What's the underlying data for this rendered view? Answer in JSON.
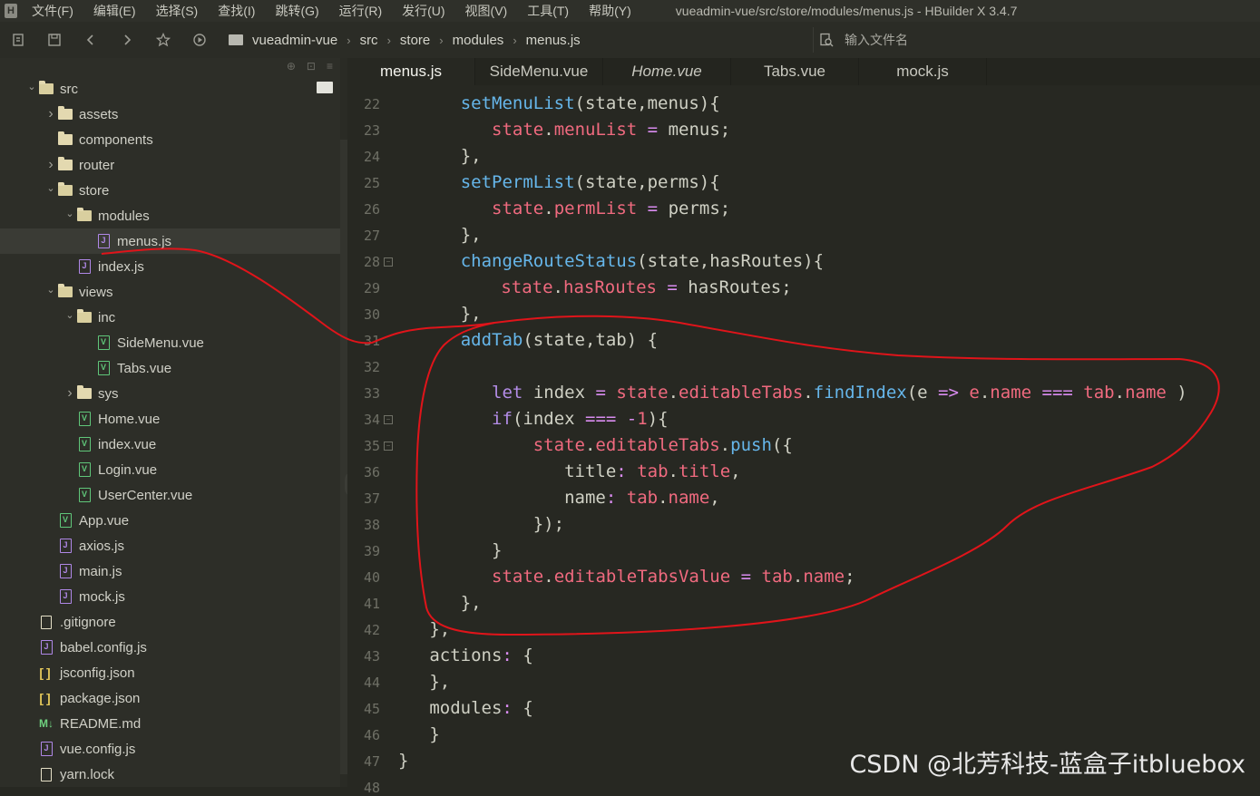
{
  "app": {
    "title": "vueadmin-vue/src/store/modules/menus.js - HBuilder X 3.4.7",
    "logo": "H"
  },
  "menu": [
    "文件(F)",
    "编辑(E)",
    "选择(S)",
    "查找(I)",
    "跳转(G)",
    "运行(R)",
    "发行(U)",
    "视图(V)",
    "工具(T)",
    "帮助(Y)"
  ],
  "toolbar": {
    "icons": [
      "new-file-icon",
      "save-icon",
      "back-icon",
      "forward-icon",
      "star-icon",
      "run-icon"
    ],
    "breadcrumb": [
      "vueadmin-vue",
      "src",
      "store",
      "modules",
      "menus.js"
    ],
    "search_placeholder": "输入文件名"
  },
  "tree": [
    {
      "label": "src",
      "type": "folder",
      "depth": 0,
      "expanded": true
    },
    {
      "label": "assets",
      "type": "folder",
      "depth": 1,
      "expanded": false
    },
    {
      "label": "components",
      "type": "folder",
      "depth": 1,
      "expanded": null
    },
    {
      "label": "router",
      "type": "folder",
      "depth": 1,
      "expanded": false
    },
    {
      "label": "store",
      "type": "folder",
      "depth": 1,
      "expanded": true
    },
    {
      "label": "modules",
      "type": "folder",
      "depth": 2,
      "expanded": true
    },
    {
      "label": "menus.js",
      "type": "js",
      "depth": 3,
      "selected": true
    },
    {
      "label": "index.js",
      "type": "js",
      "depth": 2
    },
    {
      "label": "views",
      "type": "folder",
      "depth": 1,
      "expanded": true
    },
    {
      "label": "inc",
      "type": "folder",
      "depth": 2,
      "expanded": true
    },
    {
      "label": "SideMenu.vue",
      "type": "vue",
      "depth": 3
    },
    {
      "label": "Tabs.vue",
      "type": "vue",
      "depth": 3
    },
    {
      "label": "sys",
      "type": "folder",
      "depth": 2,
      "expanded": false
    },
    {
      "label": "Home.vue",
      "type": "vue",
      "depth": 2
    },
    {
      "label": "index.vue",
      "type": "vue",
      "depth": 2
    },
    {
      "label": "Login.vue",
      "type": "vue",
      "depth": 2
    },
    {
      "label": "UserCenter.vue",
      "type": "vue",
      "depth": 2
    },
    {
      "label": "App.vue",
      "type": "vue",
      "depth": 1
    },
    {
      "label": "axios.js",
      "type": "js",
      "depth": 1
    },
    {
      "label": "main.js",
      "type": "js",
      "depth": 1
    },
    {
      "label": "mock.js",
      "type": "js",
      "depth": 1
    },
    {
      "label": ".gitignore",
      "type": "plain",
      "depth": 0
    },
    {
      "label": "babel.config.js",
      "type": "js",
      "depth": 0
    },
    {
      "label": "jsconfig.json",
      "type": "json",
      "depth": 0
    },
    {
      "label": "package.json",
      "type": "json",
      "depth": 0
    },
    {
      "label": "README.md",
      "type": "md",
      "depth": 0
    },
    {
      "label": "vue.config.js",
      "type": "js",
      "depth": 0
    },
    {
      "label": "yarn.lock",
      "type": "plain",
      "depth": 0
    }
  ],
  "tabs": [
    {
      "label": "menus.js",
      "active": true,
      "italic": false
    },
    {
      "label": "SideMenu.vue",
      "active": false,
      "italic": false
    },
    {
      "label": "Home.vue",
      "active": false,
      "italic": true
    },
    {
      "label": "Tabs.vue",
      "active": false,
      "italic": false
    },
    {
      "label": "mock.js",
      "active": false,
      "italic": false
    }
  ],
  "code": [
    {
      "ln": "22",
      "indent": 2,
      "fold": false,
      "tokens": [
        [
          "fn",
          "setMenuList"
        ],
        [
          "tx",
          "(state,menus){"
        ]
      ]
    },
    {
      "ln": "23",
      "indent": 3,
      "fold": false,
      "tokens": [
        [
          "pr",
          "state"
        ],
        [
          "tx",
          "."
        ],
        [
          "pr",
          "menuList"
        ],
        [
          "tx",
          " "
        ],
        [
          "op",
          "="
        ],
        [
          "tx",
          " menus;"
        ]
      ]
    },
    {
      "ln": "24",
      "indent": 2,
      "fold": false,
      "tokens": [
        [
          "tx",
          "},"
        ]
      ]
    },
    {
      "ln": "25",
      "indent": 2,
      "fold": false,
      "tokens": [
        [
          "fn",
          "setPermList"
        ],
        [
          "tx",
          "(state,perms){"
        ]
      ]
    },
    {
      "ln": "26",
      "indent": 3,
      "fold": false,
      "tokens": [
        [
          "pr",
          "state"
        ],
        [
          "tx",
          "."
        ],
        [
          "pr",
          "permList"
        ],
        [
          "tx",
          " "
        ],
        [
          "op",
          "="
        ],
        [
          "tx",
          " perms;"
        ]
      ]
    },
    {
      "ln": "27",
      "indent": 2,
      "fold": false,
      "tokens": [
        [
          "tx",
          "},"
        ]
      ]
    },
    {
      "ln": "28",
      "indent": 2,
      "fold": true,
      "tokens": [
        [
          "fn",
          "changeRouteStatus"
        ],
        [
          "tx",
          "(state,hasRoutes){"
        ]
      ]
    },
    {
      "ln": "29",
      "indent": 3.3,
      "fold": false,
      "tokens": [
        [
          "pr",
          "state"
        ],
        [
          "tx",
          "."
        ],
        [
          "pr",
          "hasRoutes"
        ],
        [
          "tx",
          " "
        ],
        [
          "op",
          "="
        ],
        [
          "tx",
          " hasRoutes;"
        ]
      ]
    },
    {
      "ln": "30",
      "indent": 2,
      "fold": false,
      "tokens": [
        [
          "tx",
          "},"
        ]
      ]
    },
    {
      "ln": "31",
      "indent": 2,
      "fold": false,
      "tokens": [
        [
          "fn",
          "addTab"
        ],
        [
          "tx",
          "(state,tab) {"
        ]
      ]
    },
    {
      "ln": "32",
      "indent": 0,
      "fold": false,
      "tokens": []
    },
    {
      "ln": "33",
      "indent": 3,
      "fold": false,
      "tokens": [
        [
          "kw",
          "let"
        ],
        [
          "tx",
          " index "
        ],
        [
          "op",
          "="
        ],
        [
          "tx",
          " "
        ],
        [
          "pr",
          "state"
        ],
        [
          "tx",
          "."
        ],
        [
          "pr",
          "editableTabs"
        ],
        [
          "tx",
          "."
        ],
        [
          "fn",
          "findIndex"
        ],
        [
          "tx",
          "(e "
        ],
        [
          "op",
          "=>"
        ],
        [
          "tx",
          " "
        ],
        [
          "pr",
          "e"
        ],
        [
          "tx",
          "."
        ],
        [
          "pr",
          "name"
        ],
        [
          "tx",
          " "
        ],
        [
          "op",
          "==="
        ],
        [
          "tx",
          " "
        ],
        [
          "pr",
          "tab"
        ],
        [
          "tx",
          "."
        ],
        [
          "pr",
          "name"
        ],
        [
          "tx",
          " )"
        ]
      ]
    },
    {
      "ln": "34",
      "indent": 3,
      "fold": true,
      "tokens": [
        [
          "kw",
          "if"
        ],
        [
          "tx",
          "(index "
        ],
        [
          "op",
          "==="
        ],
        [
          "tx",
          " "
        ],
        [
          "op",
          "-"
        ],
        [
          "nm",
          "1"
        ],
        [
          "tx",
          "){"
        ]
      ]
    },
    {
      "ln": "35",
      "indent": 4.33,
      "fold": true,
      "tokens": [
        [
          "pr",
          "state"
        ],
        [
          "tx",
          "."
        ],
        [
          "pr",
          "editableTabs"
        ],
        [
          "tx",
          "."
        ],
        [
          "fn",
          "push"
        ],
        [
          "tx",
          "({"
        ]
      ]
    },
    {
      "ln": "36",
      "indent": 5.33,
      "fold": false,
      "tokens": [
        [
          "tx",
          "title"
        ],
        [
          "op",
          ":"
        ],
        [
          "tx",
          " "
        ],
        [
          "pr",
          "tab"
        ],
        [
          "tx",
          "."
        ],
        [
          "pr",
          "title"
        ],
        [
          "tx",
          ","
        ]
      ]
    },
    {
      "ln": "37",
      "indent": 5.33,
      "fold": false,
      "tokens": [
        [
          "tx",
          "name"
        ],
        [
          "op",
          ":"
        ],
        [
          "tx",
          " "
        ],
        [
          "pr",
          "tab"
        ],
        [
          "tx",
          "."
        ],
        [
          "pr",
          "name"
        ],
        [
          "tx",
          ","
        ]
      ]
    },
    {
      "ln": "38",
      "indent": 4.33,
      "fold": false,
      "tokens": [
        [
          "tx",
          "});"
        ]
      ]
    },
    {
      "ln": "39",
      "indent": 3,
      "fold": false,
      "tokens": [
        [
          "tx",
          "}"
        ]
      ]
    },
    {
      "ln": "40",
      "indent": 3,
      "fold": false,
      "tokens": [
        [
          "pr",
          "state"
        ],
        [
          "tx",
          "."
        ],
        [
          "pr",
          "editableTabsValue"
        ],
        [
          "tx",
          " "
        ],
        [
          "op",
          "="
        ],
        [
          "tx",
          " "
        ],
        [
          "pr",
          "tab"
        ],
        [
          "tx",
          "."
        ],
        [
          "pr",
          "name"
        ],
        [
          "tx",
          ";"
        ]
      ]
    },
    {
      "ln": "41",
      "indent": 2,
      "fold": false,
      "tokens": [
        [
          "tx",
          "},"
        ]
      ]
    },
    {
      "ln": "42",
      "indent": 1,
      "fold": false,
      "tokens": [
        [
          "tx",
          "},"
        ]
      ]
    },
    {
      "ln": "43",
      "indent": 1,
      "fold": false,
      "tokens": [
        [
          "tx",
          "actions"
        ],
        [
          "op",
          ":"
        ],
        [
          "tx",
          " {"
        ]
      ]
    },
    {
      "ln": "44",
      "indent": 1,
      "fold": false,
      "tokens": [
        [
          "tx",
          "},"
        ]
      ]
    },
    {
      "ln": "45",
      "indent": 1,
      "fold": false,
      "tokens": [
        [
          "tx",
          "modules"
        ],
        [
          "op",
          ":"
        ],
        [
          "tx",
          " {"
        ]
      ]
    },
    {
      "ln": "46",
      "indent": 1,
      "fold": false,
      "tokens": [
        [
          "tx",
          "}"
        ]
      ]
    },
    {
      "ln": "47",
      "indent": 0,
      "fold": false,
      "tokens": [
        [
          "tx",
          "}"
        ]
      ]
    },
    {
      "ln": "48",
      "indent": 0,
      "fold": false,
      "tokens": []
    }
  ],
  "colors": {
    "annotation": "#e0141a",
    "function": "#66b6ea",
    "property": "#f06a7f",
    "keyword": "#b48de8"
  },
  "watermark": "CSDN @北芳科技-蓝盒子itbluebox"
}
